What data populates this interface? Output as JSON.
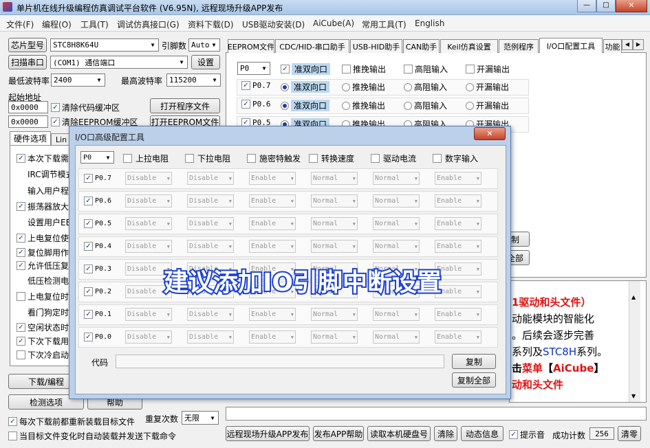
{
  "window": {
    "title": "单片机在线升级编程仿真调试平台软件 (V6.95N), 远程现场升级APP发布",
    "controls": [
      "—",
      "□",
      "✕"
    ]
  },
  "menu": [
    "文件(F)",
    "编程(O)",
    "工具(T)",
    "调试仿真接口(G)",
    "资料下载(D)",
    "USB驱动安装(D)",
    "AiCube(A)",
    "常用工具(T)",
    "English"
  ],
  "left": {
    "chip_btn": "芯片型号",
    "chip_value": "STC8H8K64U",
    "pins_label": "引脚数",
    "pins_value": "Auto",
    "scan_btn": "扫描串口",
    "port_value": "(COM1) 通信端口",
    "settings_btn": "设置",
    "min_baud_label": "最低波特率",
    "min_baud_value": "2400",
    "max_baud_label": "最高波特率",
    "max_baud_value": "115200",
    "start_addr_label": "起始地址",
    "addr1": "0x0000",
    "clear_code": "清除代码缓冲区",
    "open_prog_btn": "打开程序文件",
    "addr2": "0x0000",
    "clear_eeprom": "清除EEPROM缓冲区",
    "open_eeprom_btn": "打开EEPROM文件",
    "hw_tabs": [
      "硬件选项",
      "Lin"
    ],
    "hw_items": [
      {
        "text": "本次下载需",
        "cb": true
      },
      {
        "text": "IRC调节模式",
        "cb": null
      },
      {
        "text": "输入用户程序",
        "cb": null
      },
      {
        "text": "振荡器放大",
        "cb": true
      },
      {
        "text": "设置用户EE",
        "cb": null
      },
      {
        "text": "上电复位使",
        "cb": true
      },
      {
        "text": "复位脚用作",
        "cb": true
      },
      {
        "text": "允许低压复",
        "cb": true
      },
      {
        "text": "低压检测电",
        "cb": null
      },
      {
        "text": "上电复位时",
        "cb": false
      },
      {
        "text": "看门狗定时",
        "cb": null
      },
      {
        "text": "空闲状态时",
        "cb": true
      },
      {
        "text": "下次下载用",
        "cb": true
      },
      {
        "text": "下次冷启动",
        "cb": false
      }
    ],
    "download_btn": "下载/编程",
    "check_btn": "检测选项",
    "help_btn": "帮助",
    "reload_each": "每次下载前都重新装载目标文件",
    "auto_send": "当目标文件变化时自动装载并发送下载命令",
    "repeat_label": "重复次数",
    "repeat_value": "无限"
  },
  "tabs": [
    "EEPROM文件",
    "CDC/HID-串口助手",
    "USB-HID助手",
    "CAN助手",
    "Keil仿真设置",
    "范例程序",
    "I/O口配置工具",
    "功能"
  ],
  "io_panel": {
    "port_value": "P0",
    "modes": [
      "准双向口",
      "推挽输出",
      "高阻输入",
      "开漏输出"
    ],
    "rows": [
      "P0.7",
      "P0.6",
      "P0.5"
    ],
    "partial_btns": [
      "制",
      "全部"
    ]
  },
  "bottom_text": {
    "line1": "1驱动和头文件）",
    "line2": "动能模块的智能化",
    "line3": "。后续会逐步完善",
    "line4a": "系列及",
    "line4b": "STC8H",
    "line4c": "系列。",
    "line5a": "击",
    "line5b": "菜单",
    "line5c": "【",
    "line5d": "AiCube",
    "line5e": "】",
    "line6": "动和头文件"
  },
  "bottom_bar": {
    "remote_btn": "远程现场升级APP发布",
    "publish_help_btn": "发布APP帮助",
    "read_disk_btn": "读取本机硬盘号",
    "clear_btn": "清除",
    "dyn_info_btn": "动态信息",
    "beep_label": "提示音",
    "success_label": "成功计数",
    "success_value": "256",
    "clear_zero_btn": "清零"
  },
  "dialog": {
    "title": "I/O口高级配置工具",
    "port_value": "P0",
    "headers": [
      "上拉电阻",
      "下拉电阻",
      "施密特触发",
      "转换速度",
      "驱动电流",
      "数字输入"
    ],
    "rows": [
      {
        "pin": "P0.7",
        "vals": [
          "Disable",
          "Disable",
          "Enable",
          "Normal",
          "Normal",
          "Enable"
        ]
      },
      {
        "pin": "P0.6",
        "vals": [
          "Disable",
          "Disable",
          "Enable",
          "Normal",
          "Normal",
          "Enable"
        ]
      },
      {
        "pin": "P0.5",
        "vals": [
          "Disable",
          "Disable",
          "Enable",
          "Normal",
          "Normal",
          "Enable"
        ]
      },
      {
        "pin": "P0.4",
        "vals": [
          "Disable",
          "Disable",
          "Enable",
          "Normal",
          "Normal",
          "Enable"
        ]
      },
      {
        "pin": "P0.3",
        "vals": [
          "Disable",
          "Disable",
          "Enable",
          "Normal",
          "Normal",
          "Enable"
        ]
      },
      {
        "pin": "P0.2",
        "vals": [
          "Disable",
          "Disable",
          "Enable",
          "Normal",
          "Normal",
          "Enable"
        ]
      },
      {
        "pin": "P0.1",
        "vals": [
          "Disable",
          "Disable",
          "Enable",
          "Normal",
          "Normal",
          "Enable"
        ]
      },
      {
        "pin": "P0.0",
        "vals": [
          "Disable",
          "Disable",
          "Enable",
          "Normal",
          "Normal",
          "Enable"
        ]
      }
    ],
    "code_label": "代码",
    "copy_btn": "复制",
    "copy_all_btn": "复制全部"
  },
  "overlay_text": "建议添加IO引脚中断设置",
  "colors": {
    "overlay_fill": "#ffffff",
    "overlay_stroke": "#1a3fd0",
    "red_text": "#e01010",
    "blue_text": "#1030c0"
  }
}
